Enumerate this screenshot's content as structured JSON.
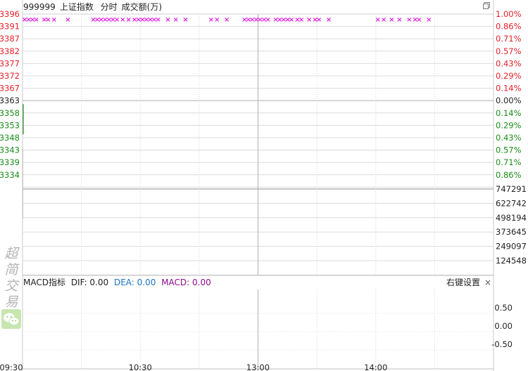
{
  "header": {
    "code": "999999",
    "name": "上证指数",
    "mode": "分时",
    "metric": "成交额(万)"
  },
  "brand": {
    "chars": [
      "超",
      "简",
      "交",
      "易"
    ]
  },
  "colors": {
    "up": "#e8202a",
    "down": "#1a8c1a",
    "neutral": "#222222",
    "marker": "#e020e0",
    "grid": "#d0d0d0",
    "dea": "#1a73c2",
    "macd": "#8a0b8a"
  },
  "price_axis": {
    "left_up": [
      "3396",
      "3391",
      "3387",
      "3382",
      "3377",
      "3372",
      "3367"
    ],
    "left_mid": "3363",
    "left_down": [
      "3358",
      "3353",
      "3348",
      "3343",
      "3339",
      "3334"
    ],
    "right_up": [
      "1.00%",
      "0.86%",
      "0.71%",
      "0.57%",
      "0.43%",
      "0.29%",
      "0.14%"
    ],
    "right_mid": "0.00%",
    "right_down": [
      "0.14%",
      "0.29%",
      "0.43%",
      "0.57%",
      "0.71%",
      "0.86%"
    ]
  },
  "volume_axis": {
    "labels": [
      "747291",
      "622742",
      "498194",
      "373645",
      "249097",
      "124548"
    ]
  },
  "macd": {
    "title": "MACD指标",
    "dif": "DIF: 0.00",
    "dea": "DEA: 0.00",
    "macd": "MACD: 0.00",
    "settings_label": "右键设置",
    "close_label": "×",
    "axis_labels": [
      "0.50",
      "0.00",
      "-0.50"
    ]
  },
  "time_axis": {
    "labels": [
      "09:30",
      "10:30",
      "13:00",
      "14:00"
    ]
  },
  "chart_data": {
    "type": "line",
    "title": "999999 上证指数 分时 成交额(万)",
    "previous_close": 3363,
    "ylim": [
      3334,
      3396
    ],
    "x": [
      "09:30"
    ],
    "series": [
      {
        "values": [
          3363
        ]
      }
    ],
    "event_marker_minutes": [
      0,
      2,
      4,
      6,
      10,
      12,
      15,
      22,
      35,
      37,
      39,
      41,
      43,
      45,
      47,
      50,
      53,
      56,
      58,
      60,
      62,
      64,
      66,
      68,
      73,
      77,
      82,
      95,
      98,
      103,
      112,
      114,
      116,
      118,
      120,
      122,
      124,
      128,
      130,
      132,
      134,
      136,
      139,
      141,
      145,
      148,
      150,
      155,
      180,
      183,
      187,
      191,
      196,
      199,
      201,
      206
    ]
  }
}
